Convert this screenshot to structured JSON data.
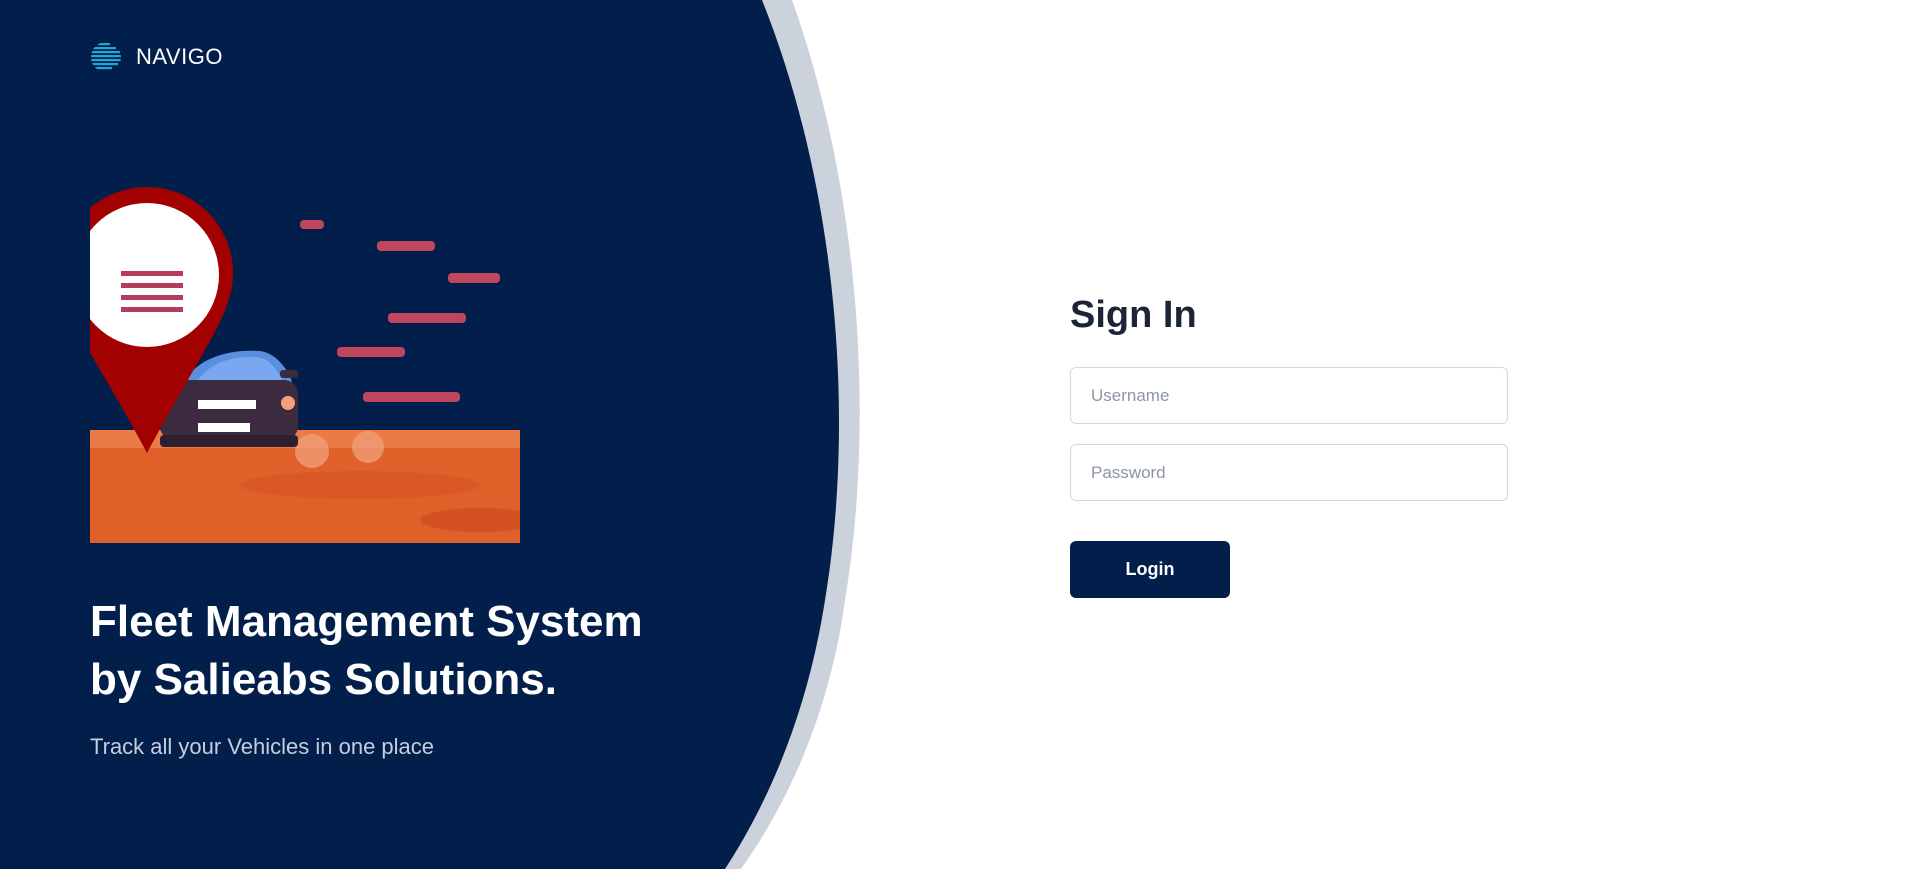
{
  "brand": {
    "name": "NAVIGO",
    "logo_icon": "globe-lines-icon"
  },
  "hero": {
    "title_line_1": "Fleet Management System",
    "title_line_2": "by Salieabs Solutions.",
    "subtitle": "Track all your Vehicles in one place",
    "illustration": "map-pin-car-illustration"
  },
  "signin": {
    "title": "Sign In",
    "username_placeholder": "Username",
    "username_value": "",
    "password_placeholder": "Password",
    "password_value": "",
    "login_label": "Login"
  },
  "colors": {
    "panel_navy": "#021f4b",
    "curve_gray": "#cbd2dc",
    "button_navy": "#021f4b",
    "title_text": "#1c2536",
    "pin_red": "#a30000",
    "ground_orange": "#e0602a"
  }
}
